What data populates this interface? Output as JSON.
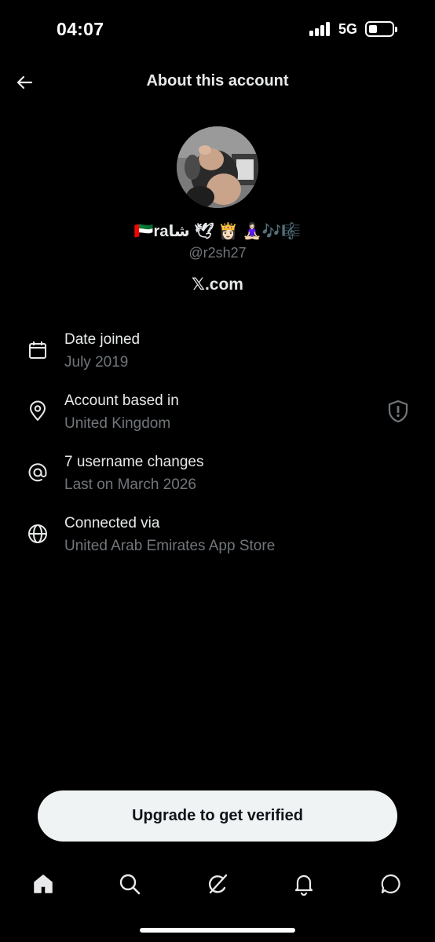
{
  "status_bar": {
    "time": "04:07",
    "network": "5G",
    "signal_bars": 4,
    "battery_level": 0.25
  },
  "header": {
    "title": "About this account",
    "back_icon": "arrow-left-icon"
  },
  "profile": {
    "display_name": "🇦🇪raشا 🕊 👸🏻 🧘🏻‍♀️🎶🎼",
    "handle": "@r2sh27",
    "site": "𝕏.com"
  },
  "info": [
    {
      "icon": "calendar-icon",
      "label": "Date joined",
      "value": "July 2019"
    },
    {
      "icon": "location-pin-icon",
      "label": "Account based in",
      "value": "United Kingdom"
    },
    {
      "icon": "at-sign-icon",
      "label": "7 username changes",
      "value": "Last on March 2026"
    },
    {
      "icon": "globe-icon",
      "label": "Connected via",
      "value": "United Arab Emirates App Store"
    }
  ],
  "cta": {
    "label": "Upgrade to get verified"
  },
  "tabbar": {
    "items": [
      "home-icon",
      "search-icon",
      "grok-icon",
      "bell-icon",
      "messages-icon"
    ]
  },
  "colors": {
    "background": "#000000",
    "primary_text": "#e7e9ea",
    "secondary_text": "#71767b",
    "button_bg": "#eff3f4",
    "button_text": "#0f1419"
  }
}
